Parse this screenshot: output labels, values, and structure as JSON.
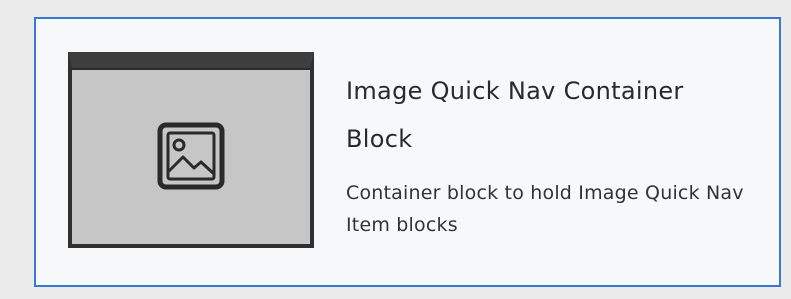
{
  "block_card": {
    "title": "Image Quick Nav Container Block",
    "description": "Container block to hold Image Quick Nav Item blocks",
    "thumbnail_icon": "image-icon"
  },
  "colors": {
    "page_bg": "#ebebeb",
    "card_bg": "#f7f8f9",
    "card_border": "#3b78d6",
    "thumb_bg": "#c6c6c6",
    "thumb_frame": "#303030",
    "text": "#2a2a2a"
  }
}
